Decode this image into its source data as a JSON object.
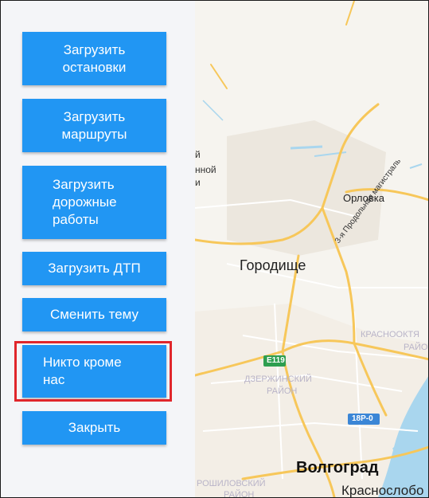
{
  "sidebar": {
    "buttons": [
      {
        "label": "Загрузить\nостановки"
      },
      {
        "label": "Загрузить\nмаршруты"
      },
      {
        "label": "Загрузить\nдорожные\nработы"
      },
      {
        "label": "Загрузить ДТП"
      },
      {
        "label": "Сменить тему"
      },
      {
        "label": "Никто кроме\nнас"
      },
      {
        "label": "Закрыть"
      }
    ]
  },
  "map": {
    "places": {
      "orlovka": "Орловка",
      "gorodishche": "Городище",
      "volgograd": "Волгоград",
      "krasnoslobodsk": "Краснослобо",
      "krasnooktyabrsky": "КРАСНООКТЯ",
      "krasnooktyabrsky2": "РАЙО",
      "dzerzhinsky": "ДЗЕРЖИНСКИЙ",
      "dzerzhinsky2": "РАЙОН",
      "voroshilovsky": "РОШИЛОВСКИЙ",
      "voroshilovsky2": "РАЙОН",
      "partial_1": "й",
      "partial_2": "нной",
      "partial_3": "и"
    },
    "roads": {
      "magistral": "3-я Продольная магистраль",
      "e119": "E119",
      "r18": "18Р-0"
    }
  },
  "colors": {
    "button": "#2196f3",
    "highlight": "#e0262b",
    "sidebar_bg": "#f4f5f8",
    "road_major": "#f7c75a",
    "water": "#a9d6ee"
  }
}
